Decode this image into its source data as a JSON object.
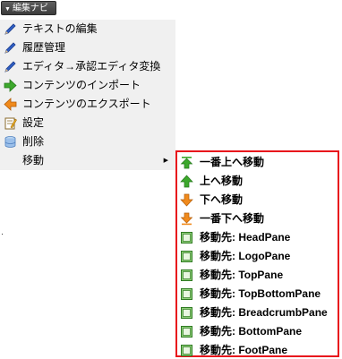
{
  "toolbar": {
    "nav_button_arrow": "▼",
    "nav_button_label": "編集ナビ"
  },
  "menu": {
    "items": [
      {
        "label": "テキストの編集",
        "icon": "pencil-icon"
      },
      {
        "label": "履歴管理",
        "icon": "pencil-icon"
      },
      {
        "label": "エディタ→承認エディタ変換",
        "icon": "pencil-icon"
      },
      {
        "label": "コンテンツのインポート",
        "icon": "arrow-right-icon"
      },
      {
        "label": "コンテンツのエクスポート",
        "icon": "arrow-left-icon"
      },
      {
        "label": "設定",
        "icon": "settings-document-icon"
      },
      {
        "label": "削除",
        "icon": "database-icon"
      },
      {
        "label": "移動",
        "icon": "",
        "submenu_arrow": "▶"
      }
    ]
  },
  "submenu": {
    "items": [
      {
        "label": "一番上へ移動",
        "icon": "arrow-up-top-icon"
      },
      {
        "label": "上へ移動",
        "icon": "arrow-up-icon"
      },
      {
        "label": "下へ移動",
        "icon": "arrow-down-icon"
      },
      {
        "label": "一番下へ移動",
        "icon": "arrow-down-bottom-icon"
      },
      {
        "label": "移動先: HeadPane",
        "icon": "pane-icon"
      },
      {
        "label": "移動先: LogoPane",
        "icon": "pane-icon"
      },
      {
        "label": "移動先: TopPane",
        "icon": "pane-icon"
      },
      {
        "label": "移動先: TopBottomPane",
        "icon": "pane-icon"
      },
      {
        "label": "移動先: BreadcrumbPane",
        "icon": "pane-icon"
      },
      {
        "label": "移動先: BottomPane",
        "icon": "pane-icon"
      },
      {
        "label": "移動先: FootPane",
        "icon": "pane-icon"
      }
    ]
  },
  "colors": {
    "highlight_border": "#e8141c",
    "menu_background": "#f0f0f0",
    "green_arrow": "#3ca82c",
    "orange_arrow": "#f08a1c",
    "pencil_blue": "#2f5fc4"
  }
}
